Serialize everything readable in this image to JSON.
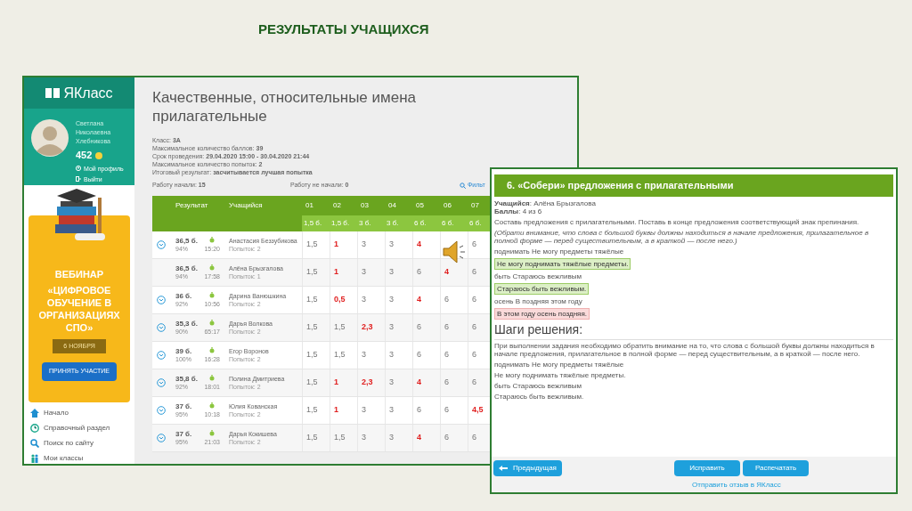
{
  "slide_title": "РЕЗУЛЬТАТЫ УЧАЩИХСЯ",
  "sidebar": {
    "logo": "ЯКласс",
    "user": {
      "name": "Светлана Николаевна Хлебникова",
      "points": "452",
      "links": [
        "Мой профиль",
        "Выйти"
      ]
    },
    "banner": {
      "heading": "ВЕБИНАР",
      "title": "«ЦИФРОВОЕ ОБУЧЕНИЕ В ОРГАНИЗАЦИЯХ СПО»",
      "date": "6 НОЯБРЯ",
      "button": "ПРИНЯТЬ УЧАСТИЕ"
    },
    "nav": [
      {
        "label": "Начало",
        "kind": "home"
      },
      {
        "label": "Справочный раздел",
        "kind": "info"
      },
      {
        "label": "Поиск по сайту",
        "kind": "search"
      },
      {
        "label": "Мои классы",
        "kind": "classes"
      }
    ]
  },
  "page": {
    "title": "Качественные, относительные имена прилагательные",
    "info": [
      "Класс: **3А**",
      "Максимальное количество баллов: **39**",
      "Срок проведения: **29.04.2020 15:00 - 30.04.2020 21:44**",
      "Максимальное количество попыток: **2**",
      "Итоговый результат: **засчитывается лучшая попытка**"
    ],
    "started": "Работу начали: **15**",
    "not_started": "Работу не начали: **0**",
    "filter": "Фильт",
    "table": {
      "columns": [
        "Результат",
        "Учащийся"
      ],
      "tasks": [
        {
          "label": "01",
          "max": "1,5 б."
        },
        {
          "label": "02",
          "max": "1,5 б."
        },
        {
          "label": "03",
          "max": "3 б."
        },
        {
          "label": "04",
          "max": "3 б."
        },
        {
          "label": "05",
          "max": "6 б."
        },
        {
          "label": "06",
          "max": "6 б."
        },
        {
          "label": "07",
          "max": "6 б."
        }
      ],
      "rows": [
        {
          "expandable": true,
          "score": "36,5 б.",
          "percent": "94%",
          "time": "15:20",
          "name": "Анастасия Беззубикова",
          "attempts": "Попыток: 2",
          "cells": [
            {
              "v": "1,5",
              "low": false
            },
            {
              "v": "1",
              "low": true
            },
            {
              "v": "3",
              "low": false
            },
            {
              "v": "3",
              "low": false
            },
            {
              "v": "4",
              "low": true
            },
            null,
            {
              "v": "6",
              "low": false
            }
          ]
        },
        {
          "expandable": false,
          "score": "36,5 б.",
          "percent": "94%",
          "time": "17:58",
          "name": "Алёна Брызгалова",
          "attempts": "Попыток: 1",
          "cells": [
            {
              "v": "1,5",
              "low": false
            },
            {
              "v": "1",
              "low": true
            },
            {
              "v": "3",
              "low": false
            },
            {
              "v": "3",
              "low": false
            },
            {
              "v": "6",
              "low": false
            },
            {
              "v": "4",
              "low": true
            },
            {
              "v": "6",
              "low": false
            }
          ]
        },
        {
          "expandable": true,
          "score": "36 б.",
          "percent": "92%",
          "time": "10:56",
          "name": "Дарина Ванюшкина",
          "attempts": "Попыток: 2",
          "cells": [
            {
              "v": "1,5",
              "low": false
            },
            {
              "v": "0,5",
              "low": true
            },
            {
              "v": "3",
              "low": false
            },
            {
              "v": "3",
              "low": false
            },
            {
              "v": "4",
              "low": true
            },
            {
              "v": "6",
              "low": false
            },
            {
              "v": "6",
              "low": false
            }
          ]
        },
        {
          "expandable": true,
          "score": "35,3 б.",
          "percent": "90%",
          "time": "65:17",
          "name": "Дарья Волкова",
          "attempts": "Попыток: 2",
          "cells": [
            {
              "v": "1,5",
              "low": false
            },
            {
              "v": "1,5",
              "low": false
            },
            {
              "v": "2,3",
              "low": true
            },
            {
              "v": "3",
              "low": false
            },
            {
              "v": "6",
              "low": false
            },
            {
              "v": "6",
              "low": false
            },
            {
              "v": "6",
              "low": false
            }
          ]
        },
        {
          "expandable": true,
          "score": "39 б.",
          "percent": "100%",
          "time": "16:28",
          "name": "Егор Воронов",
          "attempts": "Попыток: 2",
          "cells": [
            {
              "v": "1,5",
              "low": false
            },
            {
              "v": "1,5",
              "low": false
            },
            {
              "v": "3",
              "low": false
            },
            {
              "v": "3",
              "low": false
            },
            {
              "v": "6",
              "low": false
            },
            {
              "v": "6",
              "low": false
            },
            {
              "v": "6",
              "low": false
            }
          ]
        },
        {
          "expandable": true,
          "score": "35,8 б.",
          "percent": "92%",
          "time": "18:01",
          "name": "Полина Дмитриева",
          "attempts": "Попыток: 2",
          "cells": [
            {
              "v": "1,5",
              "low": false
            },
            {
              "v": "1",
              "low": true
            },
            {
              "v": "2,3",
              "low": true
            },
            {
              "v": "3",
              "low": false
            },
            {
              "v": "4",
              "low": true
            },
            {
              "v": "6",
              "low": false
            },
            {
              "v": "6",
              "low": false
            }
          ]
        },
        {
          "expandable": true,
          "score": "37 б.",
          "percent": "95%",
          "time": "10:18",
          "name": "Юлия Кованская",
          "attempts": "Попыток: 2",
          "cells": [
            {
              "v": "1,5",
              "low": false
            },
            {
              "v": "1",
              "low": true
            },
            {
              "v": "3",
              "low": false
            },
            {
              "v": "3",
              "low": false
            },
            {
              "v": "6",
              "low": false
            },
            {
              "v": "6",
              "low": false
            },
            {
              "v": "4,5",
              "low": true
            }
          ]
        },
        {
          "expandable": true,
          "score": "37 б.",
          "percent": "95%",
          "time": "21:03",
          "name": "Дарья Кокишева",
          "attempts": "Попыток: 2",
          "cells": [
            {
              "v": "1,5",
              "low": false
            },
            {
              "v": "1,5",
              "low": false
            },
            {
              "v": "3",
              "low": false
            },
            {
              "v": "3",
              "low": false
            },
            {
              "v": "4",
              "low": true
            },
            {
              "v": "6",
              "low": false
            },
            {
              "v": "6",
              "low": false
            }
          ]
        }
      ]
    }
  },
  "task": {
    "title": "6. «Собери» предложения с прилагательными",
    "student": "**Учащийся**: Алёна Брызгалова",
    "points": "**Баллы**: 4 из 6",
    "instruction": "Составь предложения с прилагательными. Поставь в конце предложения соответствующий знак препинания.",
    "hint": "(Обрати внимание, что слова с большой буквы должны находиться в начале предложения, прилагательное в полной форме — перед существительным, а в краткой — после него.)",
    "answers": [
      {
        "kind": "prompt",
        "text": "поднимать Не могу предметы тяжёлые"
      },
      {
        "kind": "correct",
        "text": "Не могу поднимать тяжёлые предметы."
      },
      {
        "kind": "prompt",
        "text": "быть Стараюсь вежливым"
      },
      {
        "kind": "correct",
        "text": "Стараюсь быть вежливым."
      },
      {
        "kind": "prompt",
        "text": "осень В поздняя этом году"
      },
      {
        "kind": "wrong",
        "text": "В этом году осень поздняя."
      }
    ],
    "steps_title": "Шаги решения:",
    "steps_text": "При выполнении задания необходимо обратить внимание на то, что слова с большой буквы должны находиться в начале предложения, прилагательное в полной форме — перед существительным, а в краткой — после него.",
    "steps": [
      "поднимать Не могу предметы тяжёлые",
      "Не могу поднимать тяжёлые предметы.",
      "быть Стараюсь вежливым",
      "Стараюсь быть вежливым."
    ],
    "prev_button": "Предыдущая",
    "buttons": [
      "Исправить",
      "Распечатать"
    ],
    "feedback_link": "Отправить отзыв в ЯКласс"
  }
}
